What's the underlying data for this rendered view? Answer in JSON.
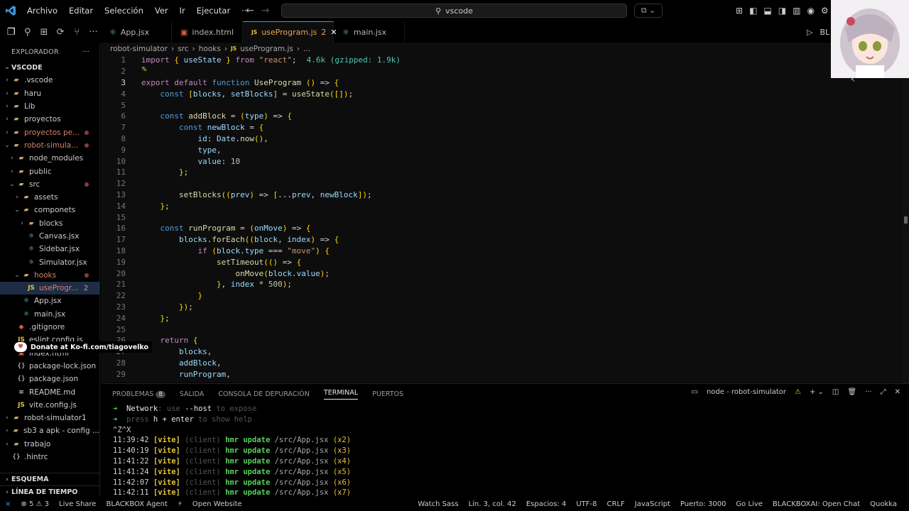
{
  "menu": [
    "Archivo",
    "Editar",
    "Selección",
    "Ver",
    "Ir",
    "Ejecutar",
    "···"
  ],
  "search": {
    "text": "vscode"
  },
  "tabs": [
    {
      "label": "App.jsx",
      "icon": "react-icon"
    },
    {
      "label": "index.html",
      "icon": "html-icon"
    },
    {
      "label": "useProgram.js",
      "icon": "js-icon",
      "badge": "2",
      "active": true
    },
    {
      "label": "main.jsx",
      "icon": "react-icon"
    }
  ],
  "run_label": "BL",
  "breadcrumb": [
    "robot-simulator",
    "src",
    "hooks",
    "useProgram.js",
    "..."
  ],
  "sidebar": {
    "title": "EXPLORADOR",
    "root": "VSCODE",
    "items": [
      {
        "label": ".vscode",
        "type": "folder",
        "depth": 1
      },
      {
        "label": "haru",
        "type": "folder",
        "depth": 1
      },
      {
        "label": "Lib",
        "type": "folder",
        "depth": 1
      },
      {
        "label": "proyectos",
        "type": "folder",
        "depth": 1
      },
      {
        "label": "proyectos pe...",
        "type": "folder",
        "depth": 1,
        "dot": true
      },
      {
        "label": "robot-simula...",
        "type": "folder",
        "depth": 1,
        "open": true,
        "dot": true
      },
      {
        "label": "node_modules",
        "type": "folder",
        "depth": 2
      },
      {
        "label": "public",
        "type": "folder",
        "depth": 2
      },
      {
        "label": "src",
        "type": "folder",
        "depth": 2,
        "open": true,
        "dot": true
      },
      {
        "label": "assets",
        "type": "folder",
        "depth": 3
      },
      {
        "label": "componets",
        "type": "folder",
        "depth": 3,
        "open": true
      },
      {
        "label": "blocks",
        "type": "folder",
        "depth": 4
      },
      {
        "label": "Canvas.jsx",
        "type": "react",
        "depth": 4
      },
      {
        "label": "Sidebar.jsx",
        "type": "react",
        "depth": 4
      },
      {
        "label": "Simulator.jsx",
        "type": "react",
        "depth": 4
      },
      {
        "label": "hooks",
        "type": "folder",
        "depth": 3,
        "open": true,
        "dot": true
      },
      {
        "label": "useProgr...",
        "type": "js",
        "depth": 4,
        "badge": "2",
        "selected": true
      },
      {
        "label": "App.jsx",
        "type": "react",
        "depth": 3
      },
      {
        "label": "main.jsx",
        "type": "react",
        "depth": 3
      },
      {
        "label": ".gitignore",
        "type": "git",
        "depth": 2
      },
      {
        "label": "eslint.config.js",
        "type": "js",
        "depth": 2
      },
      {
        "label": "index.html",
        "type": "html",
        "depth": 2
      },
      {
        "label": "package-lock.json",
        "type": "json",
        "depth": 2
      },
      {
        "label": "package.json",
        "type": "json",
        "depth": 2
      },
      {
        "label": "README.md",
        "type": "md",
        "depth": 2
      },
      {
        "label": "vite.config.js",
        "type": "js",
        "depth": 2
      },
      {
        "label": "robot-simulator1",
        "type": "folder",
        "depth": 1
      },
      {
        "label": "sb3 a apk - config ...",
        "type": "folder",
        "depth": 1
      },
      {
        "label": "trabajo",
        "type": "folder",
        "depth": 1
      },
      {
        "label": ".hintrc",
        "type": "json",
        "depth": 1
      }
    ],
    "sections": [
      "ESQUEMA",
      "LÍNEA DE TIEMPO"
    ]
  },
  "code": {
    "current_line": 3,
    "size_hint": "4.6k (gzipped: 1.9k)",
    "lines": [
      "import { useState } from \"react\";",
      "",
      "export default function UseProgram () => {",
      "    const [blocks, setBlocks] = useState([]);",
      "",
      "    const addBlock = (type) => {",
      "        const newBlock = {",
      "            id: Date.now(),",
      "            type,",
      "            value: 10",
      "        };",
      "",
      "        setBlocks((prev) => [...prev, newBlock]);",
      "    };",
      "",
      "    const runProgram = (onMove) => {",
      "        blocks.forEach((block, index) => {",
      "            if (block.type === \"move\") {",
      "                setTimeout(() => {",
      "                    onMove(block.value);",
      "                }, index * 500);",
      "            }",
      "        });",
      "    };",
      "",
      "    return {",
      "        blocks,",
      "        addBlock,",
      "        runProgram,"
    ]
  },
  "panel": {
    "tabs": [
      {
        "label": "PROBLEMAS",
        "count": "8"
      },
      {
        "label": "SALIDA"
      },
      {
        "label": "CONSOLA DE DEPURACIÓN"
      },
      {
        "label": "TERMINAL",
        "active": true
      },
      {
        "label": "PUERTOS"
      }
    ],
    "terminal_title": "node - robot-simulator",
    "lines_pre": [
      {
        "arrow": "➜",
        "label": "Network",
        "rest": ": use ",
        "flag": "--host",
        "tail": " to expose"
      },
      {
        "arrow": "➜",
        "label": "press ",
        "key": "h + enter",
        "tail": " to show help"
      }
    ],
    "ctrl": "^Z^X",
    "hmr": [
      {
        "time": "11:39:42",
        "tag": "[vite]",
        "client": "(client)",
        "msg": "hmr update",
        "path": "/src/App.jsx",
        "count": "(x2)"
      },
      {
        "time": "11:40:19",
        "tag": "[vite]",
        "client": "(client)",
        "msg": "hmr update",
        "path": "/src/App.jsx",
        "count": "(x3)"
      },
      {
        "time": "11:41:22",
        "tag": "[vite]",
        "client": "(client)",
        "msg": "hmr update",
        "path": "/src/App.jsx",
        "count": "(x4)"
      },
      {
        "time": "11:41:24",
        "tag": "[vite]",
        "client": "(client)",
        "msg": "hmr update",
        "path": "/src/App.jsx",
        "count": "(x5)"
      },
      {
        "time": "11:42:07",
        "tag": "[vite]",
        "client": "(client)",
        "msg": "hmr update",
        "path": "/src/App.jsx",
        "count": "(x6)"
      },
      {
        "time": "11:42:11",
        "tag": "[vite]",
        "client": "(client)",
        "msg": "hmr update",
        "path": "/src/App.jsx",
        "count": "(x7)"
      }
    ]
  },
  "status": {
    "left": [
      {
        "icon": "remote-icon",
        "label": "⨯"
      },
      {
        "icon": "errors-icon",
        "label": "⊗ 5 ⚠ 3"
      },
      {
        "icon": "live-share-icon",
        "label": "Live Share"
      },
      {
        "icon": "blackbox-icon",
        "label": "BLACKBOX Agent"
      },
      {
        "icon": "bolt-icon",
        "label": "⚡"
      },
      {
        "icon": "open-website-icon",
        "label": "Open Website"
      }
    ],
    "right": [
      {
        "label": "Watch Sass"
      },
      {
        "label": "Lín. 3, col. 42"
      },
      {
        "label": "Espacios: 4"
      },
      {
        "label": "UTF-8"
      },
      {
        "label": "CRLF"
      },
      {
        "label": "JavaScript"
      },
      {
        "label": "Puerto: 3000"
      },
      {
        "label": "Go Live"
      },
      {
        "label": "BLACKBOXAI: Open Chat"
      },
      {
        "label": "Quokka"
      }
    ]
  },
  "donate": "Donate at Ko-fi.com/tiagovelko",
  "colors": {
    "accent": "#3c99d4",
    "tab_active": "#e8a550",
    "folder": "#c9a46a",
    "react": "#5cc8e5",
    "js": "#e5c33a"
  }
}
